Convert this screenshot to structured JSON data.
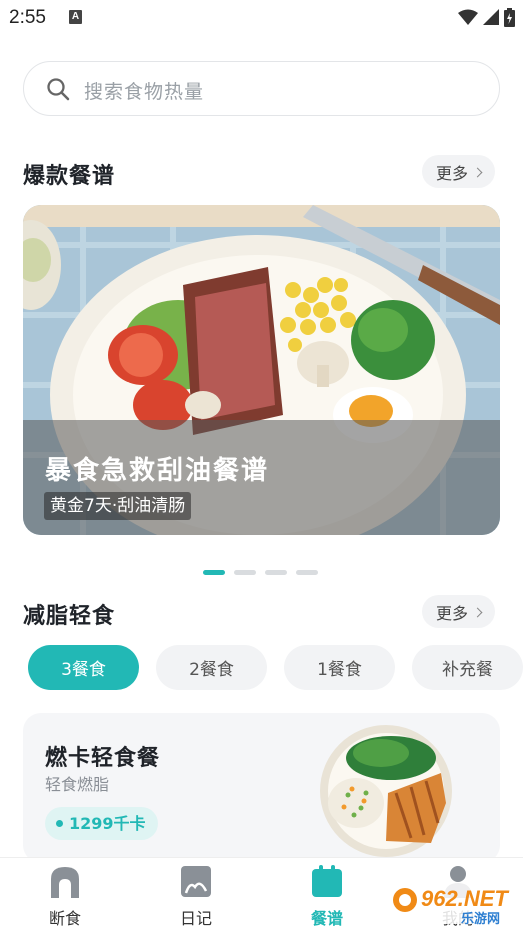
{
  "status_bar": {
    "time": "2:55",
    "notif_icon": "A"
  },
  "search": {
    "placeholder": "搜索食物热量"
  },
  "popular": {
    "title": "爆款餐谱",
    "more": "更多",
    "banner": {
      "title": "暴食急救刮油餐谱",
      "subtitle": "黄金7天·刮油清肠"
    },
    "pager": {
      "count": 4,
      "active": 0
    }
  },
  "light_meal": {
    "title": "减脂轻食",
    "more": "更多",
    "chips": [
      "3餐食",
      "2餐食",
      "1餐食",
      "补充餐"
    ],
    "selected_chip": "3餐食",
    "card": {
      "title": "燃卡轻食餐",
      "subtitle": "轻食燃脂",
      "calories": "1299千卡"
    }
  },
  "tabbar": {
    "items": [
      {
        "label": "断食",
        "icon": "fasting-icon"
      },
      {
        "label": "日记",
        "icon": "diary-icon"
      },
      {
        "label": "餐谱",
        "icon": "recipe-icon"
      },
      {
        "label": "我的",
        "icon": "profile-icon"
      }
    ],
    "active": "餐谱"
  },
  "watermark": {
    "brand": "962.NET",
    "sub": "乐游网"
  },
  "colors": {
    "accent": "#22b8b5",
    "chip_bg": "#f2f3f5",
    "card_bg": "#f5f6f8"
  }
}
